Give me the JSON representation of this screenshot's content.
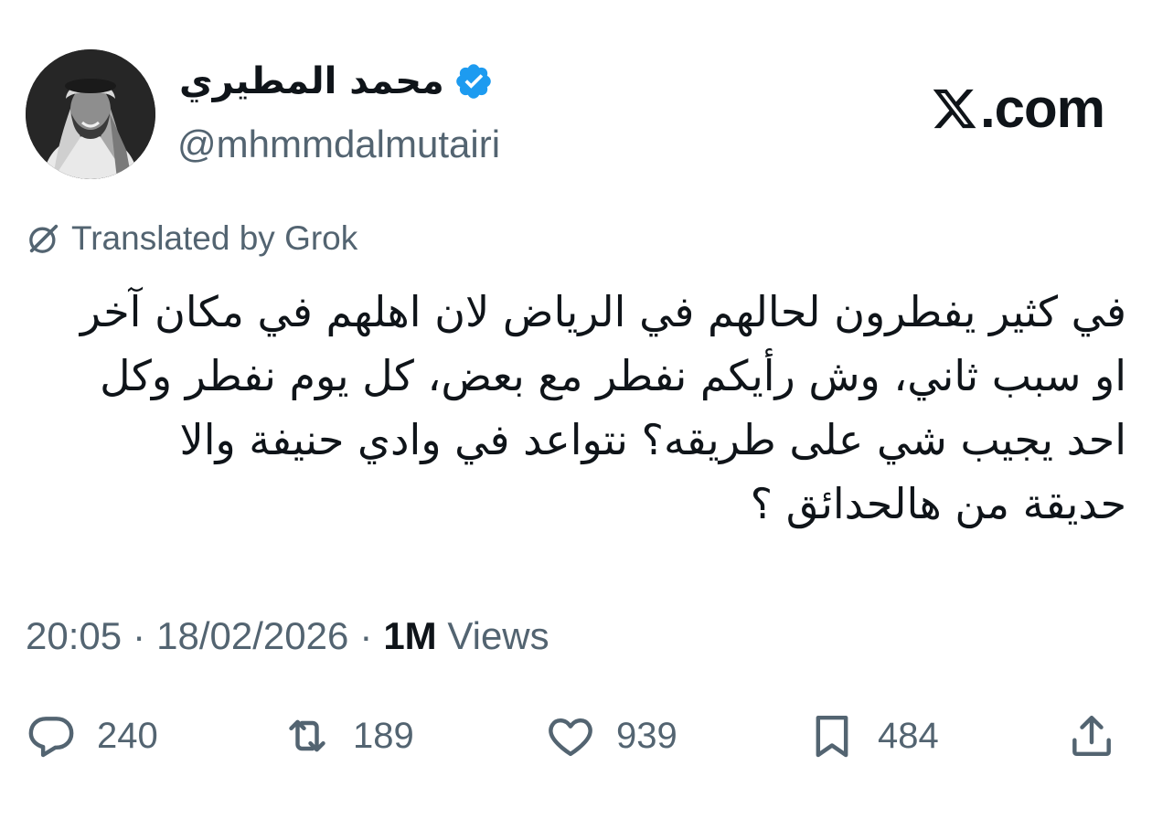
{
  "header": {
    "display_name": "محمد المطيري",
    "handle": "@mhmmdalmutairi",
    "verified_icon": "verified-badge-icon",
    "avatar_icon": "avatar-photo"
  },
  "brand": {
    "text": ".com",
    "logo_icon": "x-logo-icon"
  },
  "translation": {
    "label": "Translated by Grok",
    "icon": "grok-icon"
  },
  "tweet": {
    "lines": [
      "في كثير يفطرون لحالهم في الرياض لان اهلهم في مكان آخر",
      "او سبب ثاني، وش رأيكم نفطر مع بعض، كل يوم نفطر وكل",
      "احد يجيب شي على طريقه؟ نتواعد في وادي حنيفة والا",
      "حديقة من هالحدائق ؟"
    ]
  },
  "meta": {
    "time": "20:05",
    "separator": "·",
    "date": "18/02/2026",
    "views_count": "1M",
    "views_label": "Views"
  },
  "actions": {
    "replies": "240",
    "reposts": "189",
    "likes": "939",
    "bookmarks": "484"
  },
  "colors": {
    "text": "#0f1419",
    "secondary": "#536471",
    "verified": "#1d9bf0"
  }
}
